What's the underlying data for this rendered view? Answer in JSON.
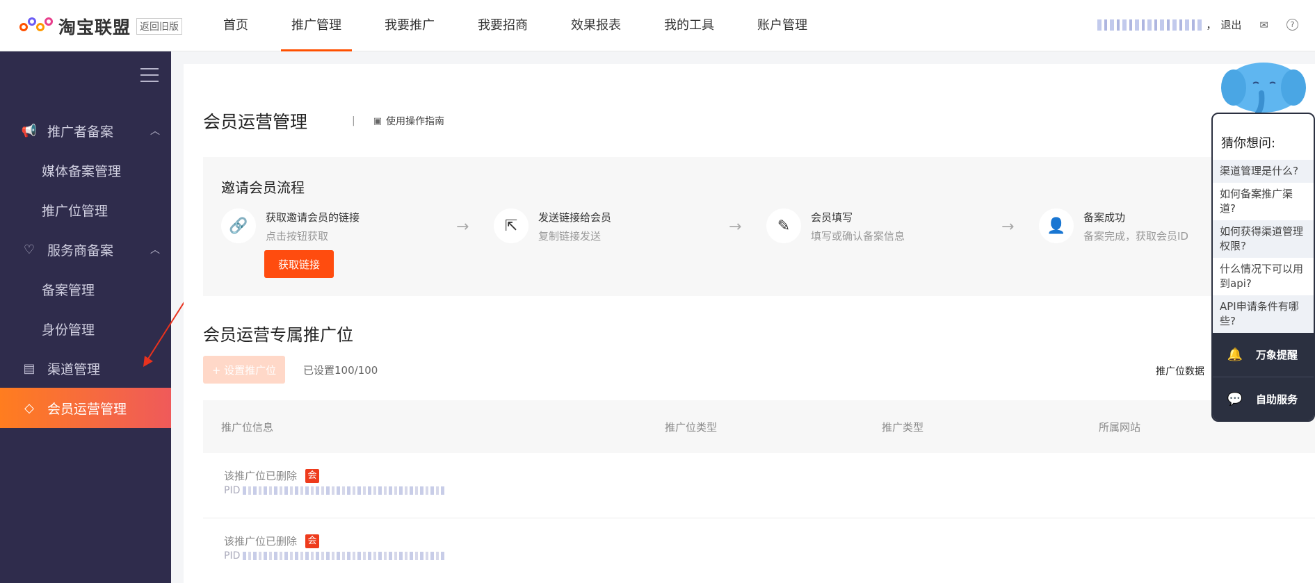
{
  "app": {
    "logo_text": "淘宝联盟",
    "logo_badge": "返回旧版"
  },
  "nav": {
    "items": [
      {
        "label": "首页"
      },
      {
        "label": "推广管理",
        "active": true
      },
      {
        "label": "我要推广"
      },
      {
        "label": "我要招商"
      },
      {
        "label": "效果报表"
      },
      {
        "label": "我的工具"
      },
      {
        "label": "账户管理"
      }
    ]
  },
  "topright": {
    "logout": "退出",
    "separator": "，",
    "mail_icon": "mail-icon",
    "help_icon": "help-icon"
  },
  "sidebar": {
    "items": [
      {
        "label": "推广者备案",
        "icon": "megaphone-icon",
        "expanded": true
      },
      {
        "label": "媒体备案管理"
      },
      {
        "label": "推广位管理"
      },
      {
        "label": "服务商备案",
        "icon": "handshake-icon",
        "expanded": true
      },
      {
        "label": "备案管理"
      },
      {
        "label": "身份管理"
      },
      {
        "label": "渠道管理",
        "icon": "chart-icon"
      },
      {
        "label": "会员运营管理",
        "icon": "diamond-icon",
        "active": true
      }
    ],
    "active_gradient": [
      "#ff7d1f",
      "#ef5a5a"
    ],
    "bg_color": "#2f2c4c"
  },
  "main": {
    "title": "会员运营管理",
    "divider": "|",
    "guide_label": "使用操作指南",
    "flow": {
      "title": "邀请会员流程",
      "steps": [
        {
          "title": "获取邀请会员的链接",
          "desc": "点击按钮获取",
          "icon": "link-icon"
        },
        {
          "title": "发送链接给会员",
          "desc": "复制链接发送",
          "icon": "share-icon"
        },
        {
          "title": "会员填写",
          "desc": "填写或确认备案信息",
          "icon": "form-edit-icon"
        },
        {
          "title": "备案成功",
          "desc": "备案完成，获取会员ID",
          "icon": "user-check-icon"
        }
      ],
      "arrow": "→",
      "button_label": "获取链接"
    },
    "section_title": "会员运营专属推广位",
    "set_button": "+ 设置推广位",
    "set_count": "已设置100/100",
    "data_link": "推广位数据",
    "table": {
      "headers": [
        "推广位信息",
        "推广位类型",
        "推广类型",
        "所属网站"
      ],
      "rows": [
        {
          "title": "该推广位已删除",
          "tag": "会",
          "pid_prefix": "PID"
        },
        {
          "title": "该推广位已删除",
          "tag": "会",
          "pid_prefix": "PID"
        }
      ]
    }
  },
  "help": {
    "title": "猜你想问:",
    "questions": [
      "渠道管理是什么?",
      "如何备案推广渠道?",
      "如何获得渠道管理权限?",
      "什么情况下可以用到api?",
      "API申请条件有哪些?"
    ],
    "buttons": [
      {
        "label": "万象提醒",
        "icon": "bell-icon"
      },
      {
        "label": "自助服务",
        "icon": "chat-icon"
      }
    ]
  },
  "colors": {
    "accent": "#ff5000",
    "primary_button": "#ff4c0f",
    "disabled_button": "#ffd8c8"
  }
}
